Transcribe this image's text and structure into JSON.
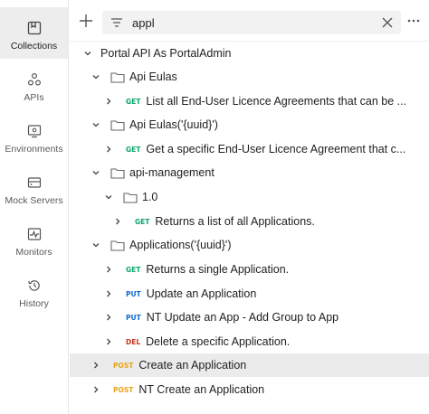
{
  "sidebar": {
    "items": [
      {
        "label": "Collections",
        "icon": "collections-icon"
      },
      {
        "label": "APIs",
        "icon": "apis-icon"
      },
      {
        "label": "Environments",
        "icon": "environments-icon"
      },
      {
        "label": "Mock Servers",
        "icon": "mock-servers-icon"
      },
      {
        "label": "Monitors",
        "icon": "monitors-icon"
      },
      {
        "label": "History",
        "icon": "history-icon"
      }
    ]
  },
  "search": {
    "value": "appl"
  },
  "colors": {
    "get": "#0aa56b",
    "put": "#0c6cd4",
    "del": "#c9311d",
    "post": "#e8a31c"
  },
  "tree": {
    "collection": "Portal API As PortalAdmin",
    "folder_api_eulas": "Api Eulas",
    "req_list_eulas": {
      "method": "GET",
      "name": "List all End-User Licence Agreements that can be ..."
    },
    "folder_api_eulas_uuid": "Api Eulas('{uuid}')",
    "req_get_eula": {
      "method": "GET",
      "name": "Get a specific End-User Licence Agreement that c..."
    },
    "folder_api_management": "api-management",
    "folder_1_0": "1.0",
    "req_list_apps": {
      "method": "GET",
      "name": "Returns a list of all Applications."
    },
    "folder_applications_uuid": "Applications('{uuid}')",
    "req_single_app": {
      "method": "GET",
      "name": "Returns a single Application."
    },
    "req_update_app": {
      "method": "PUT",
      "name": "Update an Application"
    },
    "req_nt_update_app": {
      "method": "PUT",
      "name": "NT Update an App - Add Group to App"
    },
    "req_delete_app": {
      "method": "DEL",
      "name": "Delete a specific Application."
    },
    "req_create_app": {
      "method": "POST",
      "name": "Create an Application"
    },
    "req_nt_create_app": {
      "method": "POST",
      "name": "NT Create an Application"
    }
  }
}
